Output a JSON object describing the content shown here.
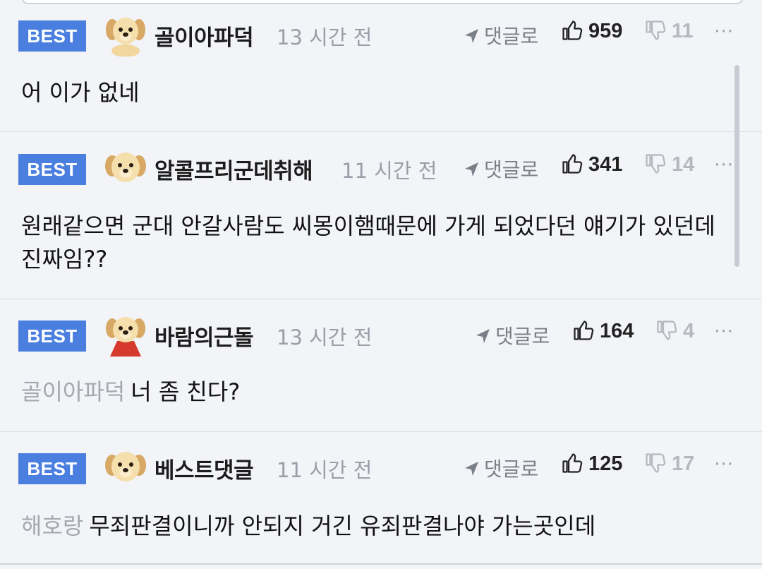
{
  "comments": [
    {
      "badge": "BEST",
      "nickname": "골이아파덕",
      "time": "13 시간 전",
      "reply_label": "댓글로",
      "likes": "959",
      "dislikes": "11",
      "more": "···",
      "mention": "",
      "text": "어 이가 없네"
    },
    {
      "badge": "BEST",
      "nickname": "알콜프리군데취해",
      "time": "11 시간 전",
      "reply_label": "댓글로",
      "likes": "341",
      "dislikes": "14",
      "more": "···",
      "mention": "",
      "text": "원래같으면 군대 안갈사람도 씨몽이햄때문에 가게 되었다던 얘기가 있던데 진짜임??"
    },
    {
      "badge": "BEST",
      "nickname": "바람의근돌",
      "time": "13 시간 전",
      "reply_label": "댓글로",
      "likes": "164",
      "dislikes": "4",
      "more": "···",
      "mention": "골이아파덕",
      "text": "너 좀 친다?"
    },
    {
      "badge": "BEST",
      "nickname": "베스트댓글",
      "time": "11 시간 전",
      "reply_label": "댓글로",
      "likes": "125",
      "dislikes": "17",
      "more": "···",
      "mention": "해호랑",
      "text": "무죄판결이니까 안되지 거긴 유죄판결나야 가는곳인데"
    }
  ],
  "icons": {
    "avatar": "puppy-avatar-icon",
    "reply": "reply-arrow-icon",
    "like": "thumbs-up-icon",
    "dislike": "thumbs-down-icon",
    "more": "more-dots-icon"
  },
  "colors": {
    "badge": "#4a7fe0",
    "background": "#f2f4f8",
    "muted": "#9a9ea6"
  }
}
